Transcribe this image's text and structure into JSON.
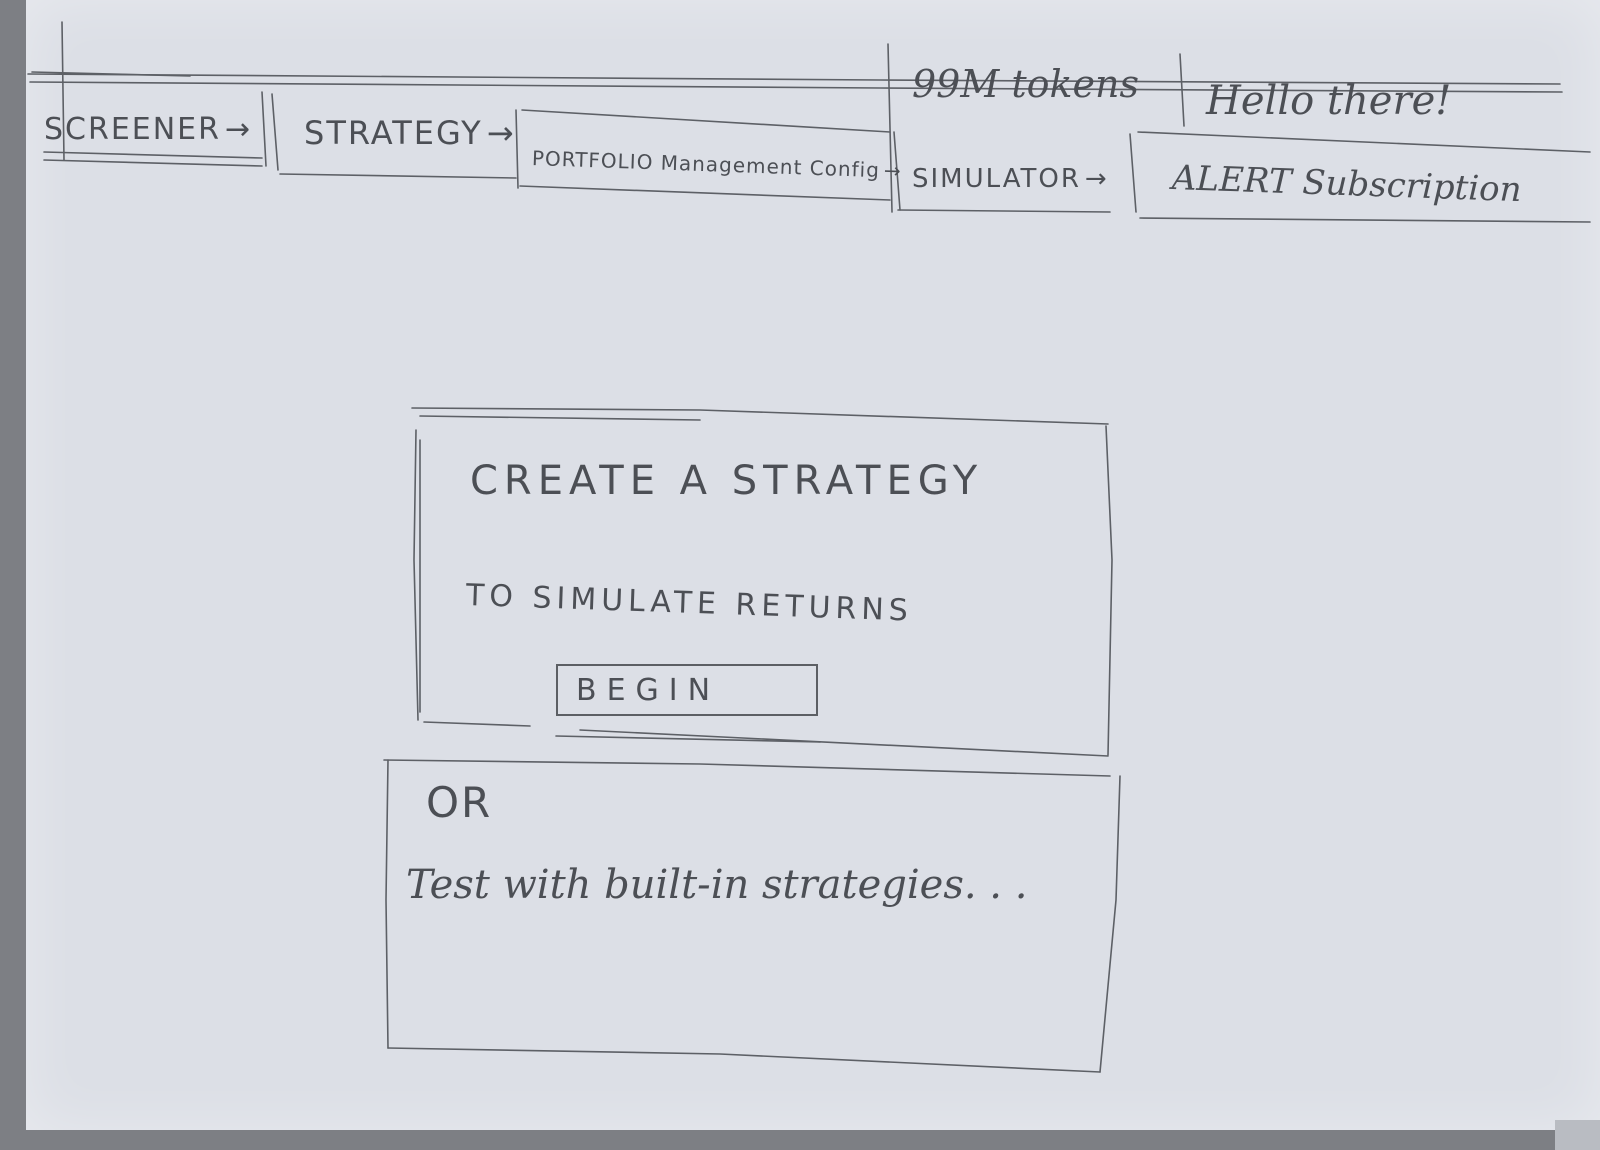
{
  "nav": {
    "tabs": [
      {
        "label": "SCREENER",
        "arrow": "→"
      },
      {
        "label": "STRATEGY",
        "arrow": "→"
      },
      {
        "label": "PORTFOLIO Management Config",
        "arrow": "→"
      },
      {
        "label": "SIMULATOR",
        "arrow": "→"
      },
      {
        "label": "ALERT Subscription",
        "arrow": ""
      }
    ],
    "tokens": "99M tokens",
    "greeting": "Hello there!"
  },
  "main": {
    "create_title": "CREATE A STRATEGY",
    "create_subtitle": "TO SIMULATE RETURNS",
    "begin_label": "BEGIN",
    "or_label": "OR",
    "builtin_text": "Test with built-in strategies. . ."
  }
}
